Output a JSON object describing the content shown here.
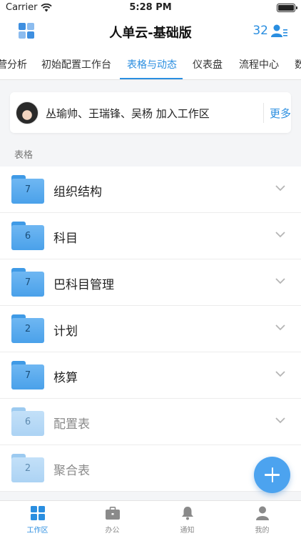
{
  "status_bar": {
    "carrier": "Carrier",
    "time": "5:28 PM"
  },
  "nav": {
    "title": "人单云-基础版",
    "member_count": "32"
  },
  "tabs": [
    {
      "label": "营分析",
      "active": false
    },
    {
      "label": "初始配置工作台",
      "active": false
    },
    {
      "label": "表格与动态",
      "active": true
    },
    {
      "label": "仪表盘",
      "active": false
    },
    {
      "label": "流程中心",
      "active": false
    },
    {
      "label": "数",
      "active": false
    }
  ],
  "notice": {
    "message": "丛瑜帅、王瑞锋、吴杨 加入工作区",
    "more": "更多"
  },
  "section_label": "表格",
  "tables": [
    {
      "count": "7",
      "name": "组织结构",
      "dimmed": false
    },
    {
      "count": "6",
      "name": "科目",
      "dimmed": false
    },
    {
      "count": "7",
      "name": "巴科目管理",
      "dimmed": false
    },
    {
      "count": "2",
      "name": "计划",
      "dimmed": false
    },
    {
      "count": "7",
      "name": "核算",
      "dimmed": false
    },
    {
      "count": "6",
      "name": "配置表",
      "dimmed": true
    },
    {
      "count": "2",
      "name": "聚合表",
      "dimmed": true
    }
  ],
  "bottom_tabs": [
    {
      "label": "工作区",
      "icon": "workspace-icon",
      "active": true
    },
    {
      "label": "办公",
      "icon": "briefcase-icon",
      "active": false
    },
    {
      "label": "通知",
      "icon": "bell-icon",
      "active": false
    },
    {
      "label": "我的",
      "icon": "person-icon",
      "active": false
    }
  ],
  "colors": {
    "accent": "#2a8ee0",
    "folder": "#4aa1ea",
    "fab": "#4ca3ef"
  }
}
